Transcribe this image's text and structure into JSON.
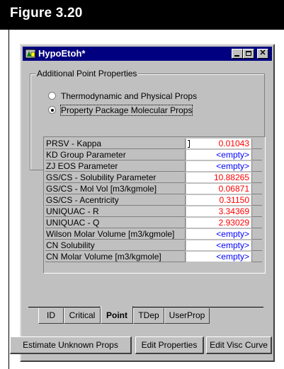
{
  "figure": {
    "label": "Figure 3.20"
  },
  "window": {
    "title": "HypoEtoh*",
    "icon": "app-icon",
    "controls": [
      "minimize-icon",
      "maximize-icon",
      "close-icon"
    ],
    "close_glyph": "✕"
  },
  "group": {
    "title": "Additional Point Properties",
    "options": [
      {
        "label": "Thermodynamic and Physical Props",
        "selected": false
      },
      {
        "label": "Property Package Molecular Props",
        "selected": true
      }
    ]
  },
  "properties": [
    {
      "name": "PRSV - Kappa",
      "value": "0.01043",
      "color": "#ff0000"
    },
    {
      "name": "KD Group Parameter",
      "value": "<empty>",
      "color": "#0000ff"
    },
    {
      "name": "ZJ EOS Parameter",
      "value": "<empty>",
      "color": "#0000ff"
    },
    {
      "name": "GS/CS - Solubility Parameter",
      "value": "10.88265",
      "color": "#ff0000"
    },
    {
      "name": "GS/CS - Mol Vol [m3/kgmole]",
      "value": "0.06871",
      "color": "#ff0000"
    },
    {
      "name": "GS/CS - Acentricity",
      "value": "0.31150",
      "color": "#ff0000"
    },
    {
      "name": "UNIQUAC - R",
      "value": "3.34369",
      "color": "#ff0000"
    },
    {
      "name": "UNIQUAC - Q",
      "value": "2.93029",
      "color": "#ff0000"
    },
    {
      "name": "Wilson Molar Volume [m3/kgmole]",
      "value": "<empty>",
      "color": "#0000ff"
    },
    {
      "name": "CN Solubility",
      "value": "<empty>",
      "color": "#0000ff"
    },
    {
      "name": "CN Molar Volume [m3/kgmole]",
      "value": "<empty>",
      "color": "#0000ff"
    }
  ],
  "tabs": [
    {
      "label": "ID",
      "active": false
    },
    {
      "label": "Critical",
      "active": false
    },
    {
      "label": "Point",
      "active": true
    },
    {
      "label": "TDep",
      "active": false
    },
    {
      "label": "UserProp",
      "active": false
    }
  ],
  "buttons": [
    {
      "label": "Estimate Unknown Props"
    },
    {
      "label": "Edit Properties"
    },
    {
      "label": "Edit Visc Curve"
    }
  ]
}
